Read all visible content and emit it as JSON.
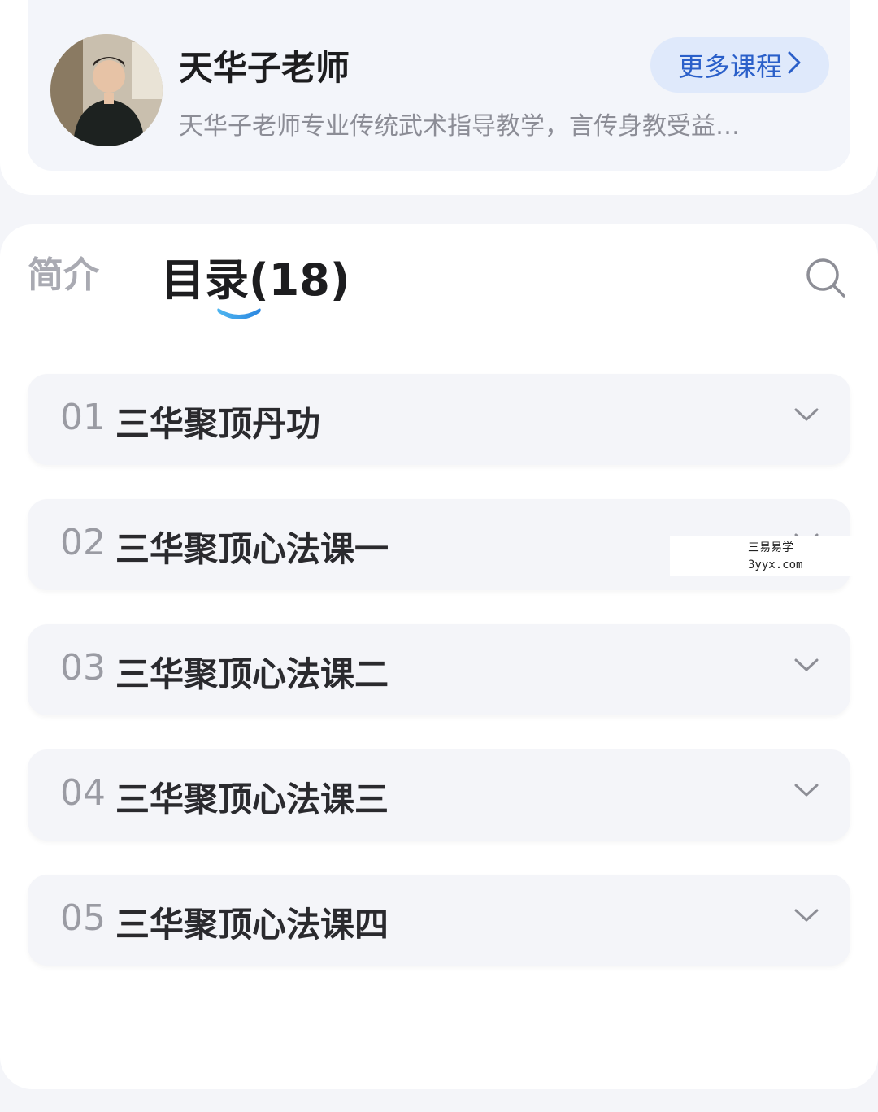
{
  "teacher": {
    "name": "天华子老师",
    "description": "天华子老师专业传统武术指导教学，言传身教受益…",
    "more_button": "更多课程"
  },
  "tabs": {
    "intro": "简介",
    "catalog": "目录(18)",
    "active": "catalog"
  },
  "lessons": [
    {
      "num": "01",
      "title": "三华聚顶丹功"
    },
    {
      "num": "02",
      "title": "三华聚顶心法课一"
    },
    {
      "num": "03",
      "title": "三华聚顶心法课二"
    },
    {
      "num": "04",
      "title": "三华聚顶心法课三"
    },
    {
      "num": "05",
      "title": "三华聚顶心法课四"
    }
  ],
  "watermark": {
    "line1": "三易易学",
    "line2": "3yyx.com"
  },
  "colors": {
    "accent": "#2a5fc9",
    "tab_indicator": "#3a9be8",
    "background": "#f4f5f9"
  },
  "icons": {
    "search": "search-icon",
    "chevron_right": "chevron-right-icon",
    "expand": "chevron-down-icon"
  }
}
